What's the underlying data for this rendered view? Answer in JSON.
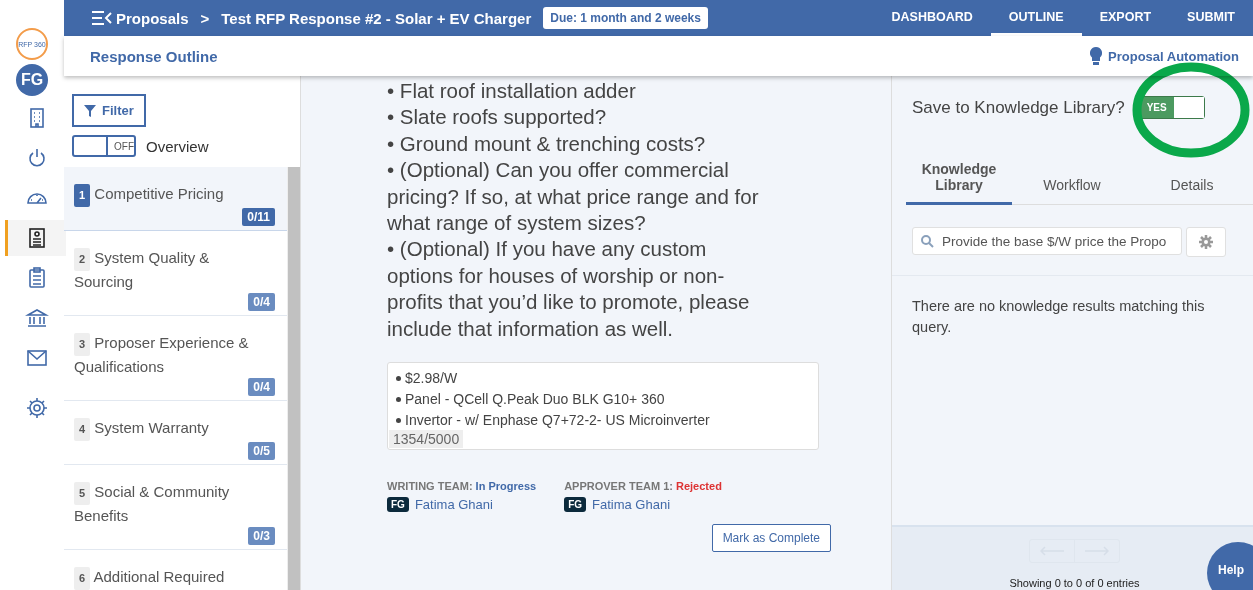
{
  "logo": {
    "text": "RFP 360"
  },
  "user": {
    "initials": "FG"
  },
  "rail": [
    {
      "selected": false
    },
    {
      "selected": false
    },
    {
      "selected": false
    },
    {
      "selected": true
    },
    {
      "selected": false
    },
    {
      "selected": false
    },
    {
      "selected": false
    },
    {
      "selected": false
    }
  ],
  "breadcrumb": {
    "root": "Proposals",
    "separator": ">",
    "title": "Test RFP Response #2 - Solar + EV Charger",
    "due": "Due: 1 month and 2 weeks"
  },
  "nav": [
    {
      "label": "DASHBOARD",
      "selected": false
    },
    {
      "label": "OUTLINE",
      "selected": true
    },
    {
      "label": "EXPORT",
      "selected": false
    },
    {
      "label": "SUBMIT",
      "selected": false
    }
  ],
  "subheader": {
    "title": "Response Outline",
    "automation": "Proposal Automation"
  },
  "outline": {
    "filter": "Filter",
    "overview": {
      "label": "Overview",
      "on": false,
      "state_text": "OFF"
    },
    "sections": [
      {
        "number": "1",
        "title": "Competitive Pricing",
        "count": "0/11",
        "selected": true
      },
      {
        "number": "2",
        "title": "System Quality & Sourcing",
        "count": "0/4",
        "selected": false
      },
      {
        "number": "3",
        "title": "Proposer Experience & Qualifications",
        "count": "0/4",
        "selected": false
      },
      {
        "number": "4",
        "title": "System Warranty",
        "count": "0/5",
        "selected": false
      },
      {
        "number": "5",
        "title": "Social & Community Benefits",
        "count": "0/3",
        "selected": false
      },
      {
        "number": "6",
        "title": "Additional Required",
        "selected": false
      }
    ]
  },
  "question": {
    "lines": [
      "• Flat roof installation adder",
      "• Slate roofs supported?",
      "• Ground mount & trenching costs?",
      "• (Optional) Can you offer commercial pricing? If so, at what price range and for what range of system sizes?",
      "• (Optional) If you have any custom options for houses of worship or non-profits that you’d like to promote, please include that information as well."
    ]
  },
  "answer": {
    "lines": [
      "$2.98/W",
      "Panel - QCell Q.Peak Duo BLK G10+ 360",
      "Invertor - w/ Enphase Q7+72-2- US Microinverter"
    ],
    "counter": "1354/5000"
  },
  "teams": [
    {
      "label": "WRITING TEAM:",
      "status": "In Progress",
      "color": "#4169a8",
      "initials": "FG",
      "member": "Fatima Ghani"
    },
    {
      "label": "APPROVER TEAM 1:",
      "status": "Rejected",
      "color": "#dd3333",
      "initials": "FG",
      "member": "Fatima Ghani"
    }
  ],
  "complete_button": "Mark as Complete",
  "right": {
    "save": {
      "label": "Save to Knowledge Library?",
      "on": true,
      "state_text": "YES"
    },
    "tabs": [
      {
        "label": "Knowledge Library",
        "selected": true
      },
      {
        "label": "Workflow",
        "selected": false
      },
      {
        "label": "Details",
        "selected": false
      }
    ],
    "search": {
      "value": "Provide the base $/W price the Propo"
    },
    "empty": "There are no knowledge results matching this query.",
    "pager": {
      "disabled": true
    },
    "showing": "Showing 0 to 0 of 0 entries"
  },
  "help": "Help"
}
